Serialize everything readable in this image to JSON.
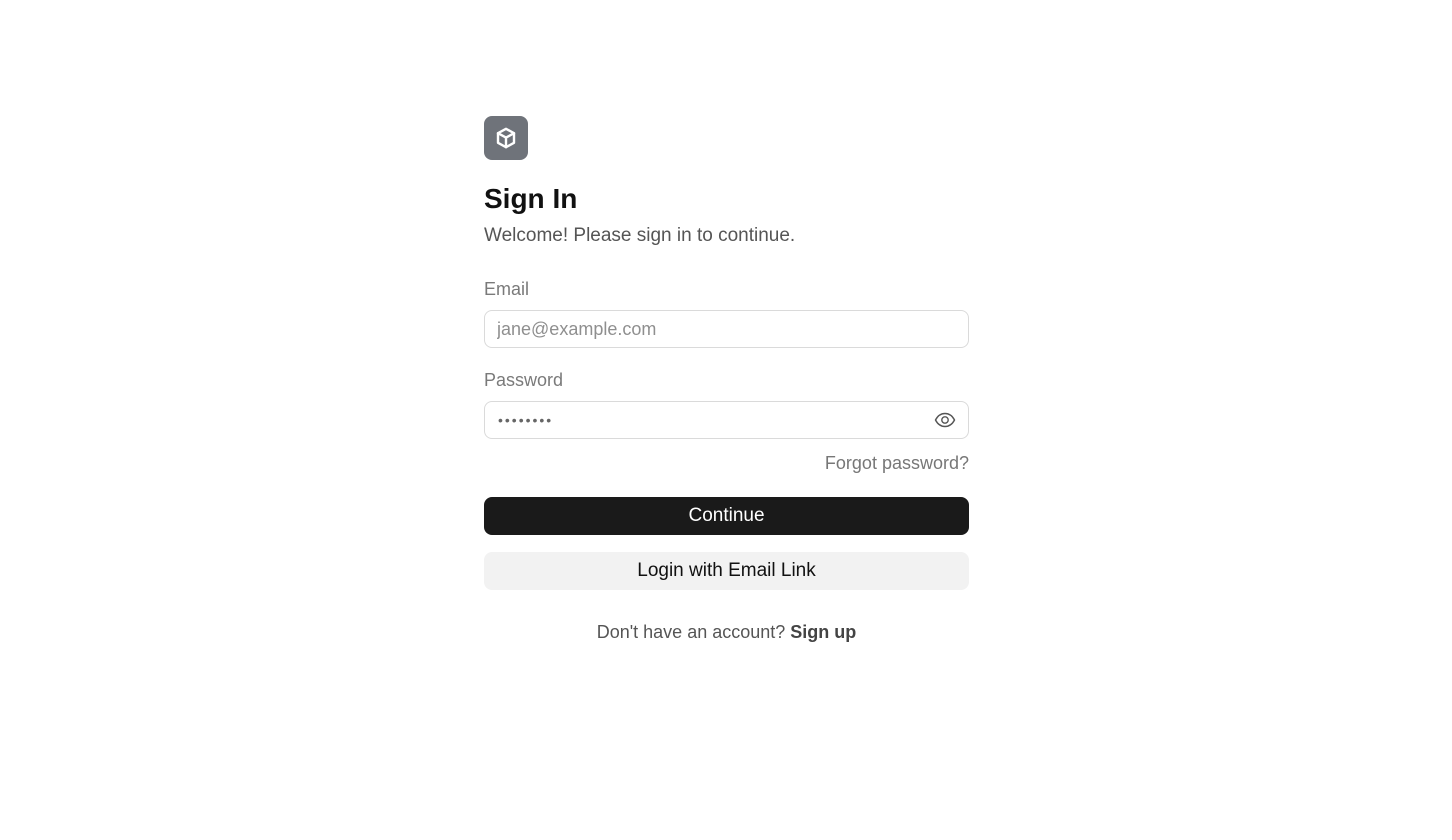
{
  "icons": {
    "logo": "cube-icon",
    "password_toggle": "eye-icon"
  },
  "colors": {
    "logo_bg": "#6f737a",
    "primary_button_bg": "#1a1a1a",
    "secondary_button_bg": "#f2f2f2"
  },
  "header": {
    "title": "Sign In",
    "subtitle": "Welcome! Please sign in to continue."
  },
  "form": {
    "email": {
      "label": "Email",
      "placeholder": "jane@example.com",
      "value": ""
    },
    "password": {
      "label": "Password",
      "masked_value": "••••••••"
    },
    "forgot_password": "Forgot password?",
    "continue_label": "Continue",
    "email_link_label": "Login with Email Link"
  },
  "footer": {
    "prompt": "Don't have an account?",
    "signup_label": "Sign up"
  }
}
